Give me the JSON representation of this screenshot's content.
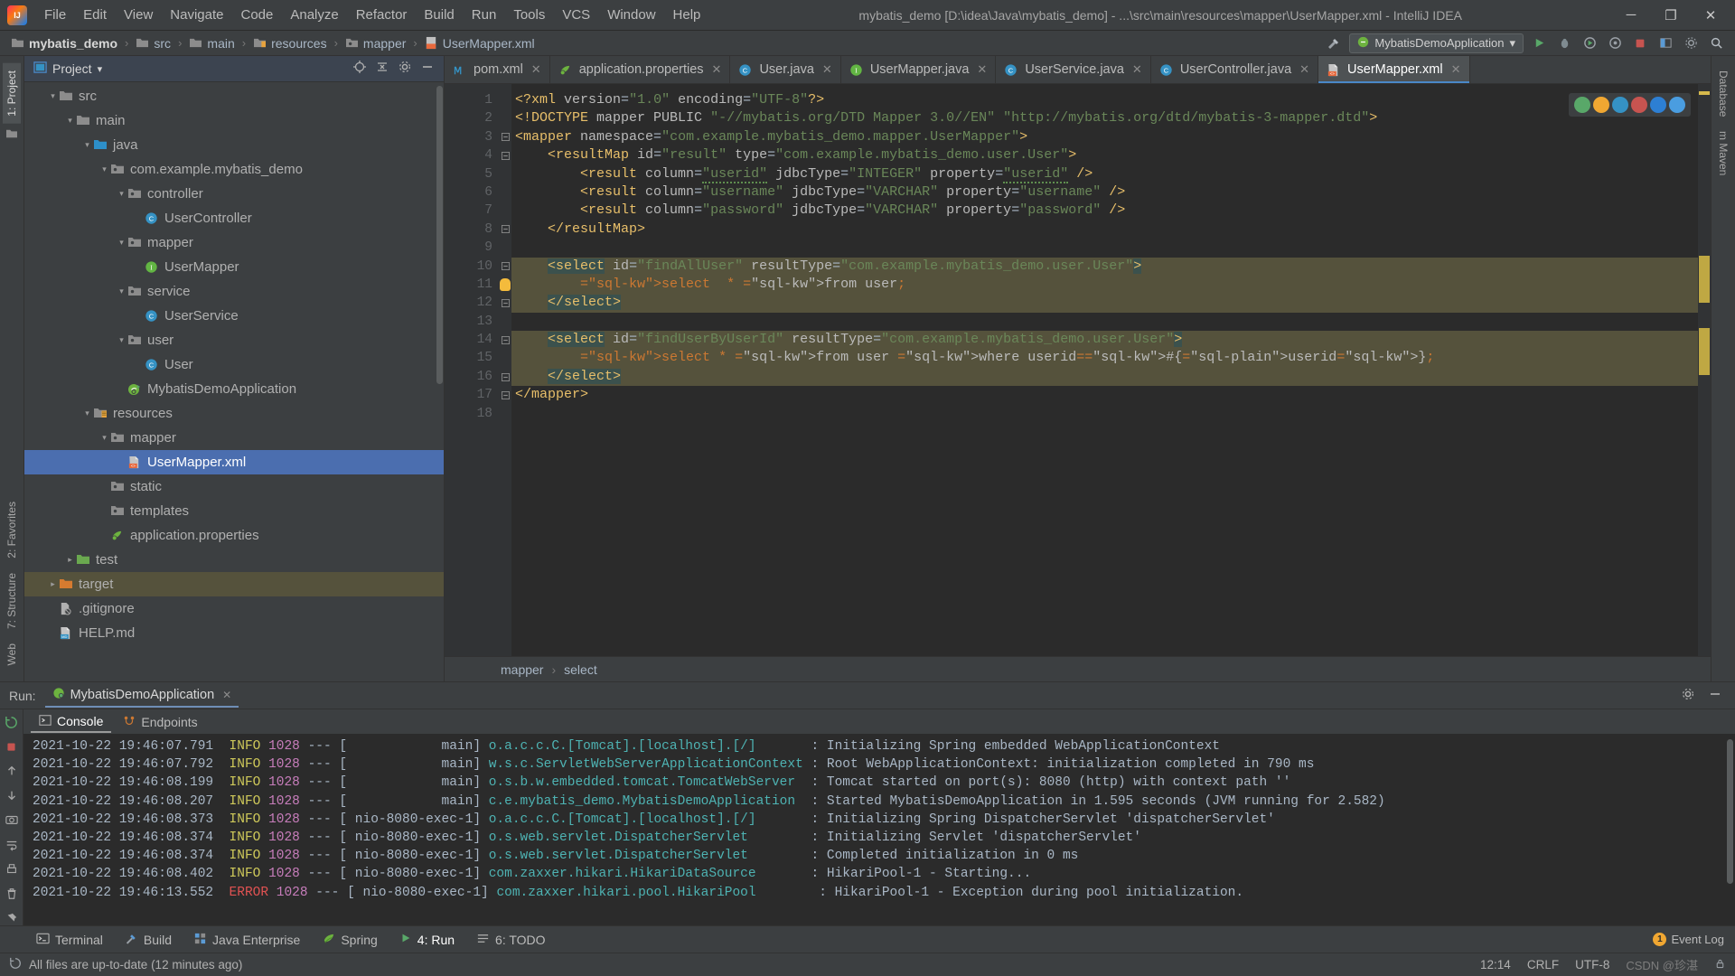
{
  "window": {
    "title": "mybatis_demo [D:\\idea\\Java\\mybatis_demo] - ...\\src\\main\\resources\\mapper\\UserMapper.xml - IntelliJ IDEA",
    "minimize": "─",
    "maximize": "❐",
    "close": "✕"
  },
  "menu": [
    {
      "label": "File"
    },
    {
      "label": "Edit"
    },
    {
      "label": "View"
    },
    {
      "label": "Navigate"
    },
    {
      "label": "Code"
    },
    {
      "label": "Analyze"
    },
    {
      "label": "Refactor"
    },
    {
      "label": "Build"
    },
    {
      "label": "Run"
    },
    {
      "label": "Tools"
    },
    {
      "label": "VCS"
    },
    {
      "label": "Window"
    },
    {
      "label": "Help"
    }
  ],
  "breadcrumb": {
    "items": [
      {
        "label": "mybatis_demo",
        "icon": "folder-module-icon",
        "bold": true
      },
      {
        "label": "src",
        "icon": "folder-icon",
        "bold": false
      },
      {
        "label": "main",
        "icon": "folder-icon",
        "bold": false
      },
      {
        "label": "resources",
        "icon": "folder-resources-icon",
        "bold": false
      },
      {
        "label": "mapper",
        "icon": "folder-package-icon",
        "bold": false
      },
      {
        "label": "UserMapper.xml",
        "icon": "xml-file-icon",
        "bold": false
      }
    ],
    "separator": "›"
  },
  "toolbar": {
    "run_config": "MybatisDemoApplication",
    "run_config_caret": "▾",
    "icons": [
      "hammer-build-icon",
      "run-icon",
      "debug-icon",
      "run-coverage-icon",
      "profile-icon",
      "stop-icon",
      "layout-icon",
      "settings-icon",
      "search-icon"
    ]
  },
  "left_rail": [
    {
      "label": "1: Project",
      "active": true
    },
    {
      "label": "2: Favorites",
      "active": false
    },
    {
      "label": "7: Structure",
      "active": false
    },
    {
      "label": "Web",
      "active": false
    }
  ],
  "right_rail": [
    {
      "label": "Database"
    },
    {
      "label": "m Maven"
    }
  ],
  "project_panel": {
    "title": "Project",
    "caret": "▾",
    "actions": [
      "locate-target-icon",
      "collapse-all-icon",
      "settings-gear-icon",
      "hide-panel-icon"
    ],
    "tree": [
      {
        "label": "src",
        "indent": 1,
        "arrow": "▾",
        "icon": "folder-icon",
        "state": "normal"
      },
      {
        "label": "main",
        "indent": 2,
        "arrow": "▾",
        "icon": "folder-icon",
        "state": "normal"
      },
      {
        "label": "java",
        "indent": 3,
        "arrow": "▾",
        "icon": "folder-source-icon",
        "state": "normal"
      },
      {
        "label": "com.example.mybatis_demo",
        "indent": 4,
        "arrow": "▾",
        "icon": "folder-package-icon",
        "state": "normal"
      },
      {
        "label": "controller",
        "indent": 5,
        "arrow": "▾",
        "icon": "folder-package-icon",
        "state": "normal"
      },
      {
        "label": "UserController",
        "indent": 6,
        "arrow": "",
        "icon": "java-class-icon",
        "state": "normal"
      },
      {
        "label": "mapper",
        "indent": 5,
        "arrow": "▾",
        "icon": "folder-package-icon",
        "state": "normal"
      },
      {
        "label": "UserMapper",
        "indent": 6,
        "arrow": "",
        "icon": "java-interface-icon",
        "state": "normal"
      },
      {
        "label": "service",
        "indent": 5,
        "arrow": "▾",
        "icon": "folder-package-icon",
        "state": "normal"
      },
      {
        "label": "UserService",
        "indent": 6,
        "arrow": "",
        "icon": "java-class-icon",
        "state": "normal"
      },
      {
        "label": "user",
        "indent": 5,
        "arrow": "▾",
        "icon": "folder-package-icon",
        "state": "normal"
      },
      {
        "label": "User",
        "indent": 6,
        "arrow": "",
        "icon": "java-class-icon",
        "state": "normal"
      },
      {
        "label": "MybatisDemoApplication",
        "indent": 5,
        "arrow": "",
        "icon": "spring-boot-icon",
        "state": "normal"
      },
      {
        "label": "resources",
        "indent": 3,
        "arrow": "▾",
        "icon": "folder-resources-icon",
        "state": "normal"
      },
      {
        "label": "mapper",
        "indent": 4,
        "arrow": "▾",
        "icon": "folder-package-icon",
        "state": "normal"
      },
      {
        "label": "UserMapper.xml",
        "indent": 5,
        "arrow": "",
        "icon": "xml-file-icon",
        "state": "selected"
      },
      {
        "label": "static",
        "indent": 4,
        "arrow": "",
        "icon": "folder-package-icon",
        "state": "normal"
      },
      {
        "label": "templates",
        "indent": 4,
        "arrow": "",
        "icon": "folder-package-icon",
        "state": "normal"
      },
      {
        "label": "application.properties",
        "indent": 4,
        "arrow": "",
        "icon": "properties-file-icon",
        "state": "normal"
      },
      {
        "label": "test",
        "indent": 2,
        "arrow": "▸",
        "icon": "folder-test-icon",
        "state": "normal"
      },
      {
        "label": "target",
        "indent": 1,
        "arrow": "▸",
        "icon": "folder-target-icon",
        "state": "highlighted"
      },
      {
        "label": ".gitignore",
        "indent": 1,
        "arrow": "",
        "icon": "gitignore-file-icon",
        "state": "normal"
      },
      {
        "label": "HELP.md",
        "indent": 1,
        "arrow": "",
        "icon": "markdown-file-icon",
        "state": "normal"
      }
    ]
  },
  "editor_tabs": [
    {
      "label": "pom.xml",
      "icon": "maven-icon",
      "active": false
    },
    {
      "label": "application.properties",
      "icon": "properties-file-icon",
      "active": false
    },
    {
      "label": "User.java",
      "icon": "java-class-icon",
      "active": false
    },
    {
      "label": "UserMapper.java",
      "icon": "java-interface-icon",
      "active": false
    },
    {
      "label": "UserService.java",
      "icon": "java-class-icon",
      "active": false
    },
    {
      "label": "UserController.java",
      "icon": "java-class-icon",
      "active": false
    },
    {
      "label": "UserMapper.xml",
      "icon": "xml-file-icon",
      "active": true
    }
  ],
  "editor": {
    "line_numbers": [
      "1",
      "2",
      "3",
      "4",
      "5",
      "6",
      "7",
      "8",
      "9",
      "10",
      "11",
      "12",
      "13",
      "14",
      "15",
      "16",
      "17",
      "18"
    ],
    "lines": [
      {
        "n": 1,
        "fold": "",
        "hl": false,
        "text": "<?xml version=\"1.0\" encoding=\"UTF-8\"?>"
      },
      {
        "n": 2,
        "fold": "",
        "hl": false,
        "text": "<!DOCTYPE mapper PUBLIC \"-//mybatis.org/DTD Mapper 3.0//EN\" \"http://mybatis.org/dtd/mybatis-3-mapper.dtd\">"
      },
      {
        "n": 3,
        "fold": "-",
        "hl": false,
        "text": "<mapper namespace=\"com.example.mybatis_demo.mapper.UserMapper\">"
      },
      {
        "n": 4,
        "fold": "-",
        "hl": false,
        "text": "    <resultMap id=\"result\" type=\"com.example.mybatis_demo.user.User\">"
      },
      {
        "n": 5,
        "fold": "",
        "hl": false,
        "text": "        <result column=\"userid\" jdbcType=\"INTEGER\" property=\"userid\" />"
      },
      {
        "n": 6,
        "fold": "",
        "hl": false,
        "text": "        <result column=\"username\" jdbcType=\"VARCHAR\" property=\"username\" />"
      },
      {
        "n": 7,
        "fold": "",
        "hl": false,
        "text": "        <result column=\"password\" jdbcType=\"VARCHAR\" property=\"password\" />"
      },
      {
        "n": 8,
        "fold": "-",
        "hl": false,
        "text": "    </resultMap>"
      },
      {
        "n": 9,
        "fold": "",
        "hl": false,
        "text": ""
      },
      {
        "n": 10,
        "fold": "-",
        "hl": true,
        "text": "    <select id=\"findAllUser\" resultType=\"com.example.mybatis_demo.user.User\">"
      },
      {
        "n": 11,
        "fold": "",
        "hl": true,
        "text": "        select  * from user;"
      },
      {
        "n": 12,
        "fold": "-",
        "hl": true,
        "text": "    </select>"
      },
      {
        "n": 13,
        "fold": "",
        "hl": false,
        "text": ""
      },
      {
        "n": 14,
        "fold": "-",
        "hl": true,
        "text": "    <select id=\"findUserByUserId\" resultType=\"com.example.mybatis_demo.user.User\">"
      },
      {
        "n": 15,
        "fold": "",
        "hl": true,
        "text": "        select * from user where userid=#{userid};"
      },
      {
        "n": 16,
        "fold": "-",
        "hl": true,
        "text": "    </select>"
      },
      {
        "n": 17,
        "fold": "-",
        "hl": false,
        "text": "</mapper>"
      },
      {
        "n": 18,
        "fold": "",
        "hl": false,
        "text": ""
      }
    ],
    "breadcrumb": {
      "first": "mapper",
      "sep": "›",
      "second": "select"
    }
  },
  "run_panel": {
    "run_label": "Run:",
    "config_name": "MybatisDemoApplication",
    "close_x": "✕",
    "tabs": [
      {
        "label": "Console",
        "icon": "console-icon",
        "active": true
      },
      {
        "label": "Endpoints",
        "icon": "endpoints-icon",
        "active": false
      }
    ],
    "header_actions": [
      "settings-gear-icon",
      "hide-panel-icon"
    ],
    "side_actions": [
      "rerun-icon",
      "stop-icon",
      "scroll-up-icon",
      "scroll-down-icon",
      "camera-icon",
      "wrap-icon",
      "print-icon",
      "trash-icon",
      "pin-icon"
    ],
    "console_lines": [
      {
        "time": "2021-10-22 19:46:07.791",
        "level": "INFO",
        "pid": "1028",
        "thread": "main",
        "logger": "o.a.c.c.C.[Tomcat].[localhost].[/]",
        "message": "Initializing Spring embedded WebApplicationContext"
      },
      {
        "time": "2021-10-22 19:46:07.792",
        "level": "INFO",
        "pid": "1028",
        "thread": "main",
        "logger": "w.s.c.ServletWebServerApplicationContext",
        "message": "Root WebApplicationContext: initialization completed in 790 ms"
      },
      {
        "time": "2021-10-22 19:46:08.199",
        "level": "INFO",
        "pid": "1028",
        "thread": "main",
        "logger": "o.s.b.w.embedded.tomcat.TomcatWebServer",
        "message": "Tomcat started on port(s): 8080 (http) with context path ''"
      },
      {
        "time": "2021-10-22 19:46:08.207",
        "level": "INFO",
        "pid": "1028",
        "thread": "main",
        "logger": "c.e.mybatis_demo.MybatisDemoApplication",
        "message": "Started MybatisDemoApplication in 1.595 seconds (JVM running for 2.582)"
      },
      {
        "time": "2021-10-22 19:46:08.373",
        "level": "INFO",
        "pid": "1028",
        "thread": "nio-8080-exec-1",
        "logger": "o.a.c.c.C.[Tomcat].[localhost].[/]",
        "message": "Initializing Spring DispatcherServlet 'dispatcherServlet'"
      },
      {
        "time": "2021-10-22 19:46:08.374",
        "level": "INFO",
        "pid": "1028",
        "thread": "nio-8080-exec-1",
        "logger": "o.s.web.servlet.DispatcherServlet",
        "message": "Initializing Servlet 'dispatcherServlet'"
      },
      {
        "time": "2021-10-22 19:46:08.374",
        "level": "INFO",
        "pid": "1028",
        "thread": "nio-8080-exec-1",
        "logger": "o.s.web.servlet.DispatcherServlet",
        "message": "Completed initialization in 0 ms"
      },
      {
        "time": "2021-10-22 19:46:08.402",
        "level": "INFO",
        "pid": "1028",
        "thread": "nio-8080-exec-1",
        "logger": "com.zaxxer.hikari.HikariDataSource",
        "message": "HikariPool-1 - Starting..."
      },
      {
        "time": "2021-10-22 19:46:13.552",
        "level": "ERROR",
        "pid": "1028",
        "thread": "nio-8080-exec-1",
        "logger": "com.zaxxer.hikari.pool.HikariPool",
        "message": "HikariPool-1 - Exception during pool initialization."
      }
    ]
  },
  "bottom_bar": {
    "buttons": [
      {
        "label": "Terminal",
        "icon": "terminal-icon",
        "active": false
      },
      {
        "label": "Build",
        "icon": "build-hammer-icon",
        "active": false
      },
      {
        "label": "Java Enterprise",
        "icon": "java-enterprise-icon",
        "active": false
      },
      {
        "label": "Spring",
        "icon": "spring-leaf-icon",
        "active": false
      },
      {
        "label": "4: Run",
        "icon": "run-play-icon",
        "active": true
      },
      {
        "label": "6: TODO",
        "icon": "todo-icon",
        "active": false
      }
    ],
    "event_log": {
      "count": "1",
      "label": "Event Log"
    }
  },
  "status_bar": {
    "message": "All files are up-to-date (12 minutes ago)",
    "time": "12:14",
    "line_separator": "CRLF",
    "encoding": "UTF-8",
    "watermark": "CSDN @珍湛"
  }
}
